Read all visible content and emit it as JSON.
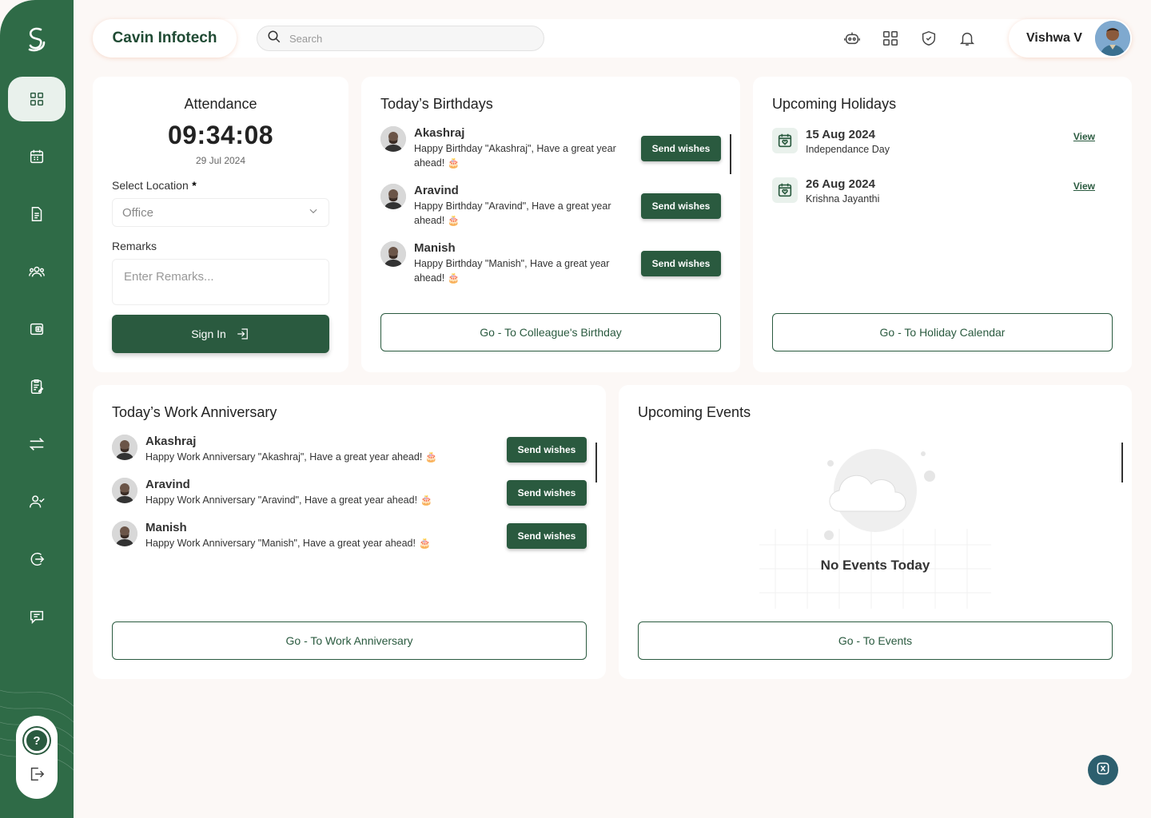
{
  "company": "Cavin Infotech",
  "search": {
    "placeholder": "Search"
  },
  "user": {
    "name": "Vishwa V"
  },
  "attendance": {
    "title": "Attendance",
    "time": "09:34:08",
    "date": "29 Jul 2024",
    "location_label": "Select Location",
    "required_mark": "*",
    "location_value": "Office",
    "remarks_label": "Remarks",
    "remarks_placeholder": "Enter Remarks...",
    "signin_label": "Sign In"
  },
  "birthdays": {
    "title": "Today’s Birthdays",
    "items": [
      {
        "name": "Akashraj",
        "message": "Happy Birthday \"Akashraj\", Have a great year ahead! 🎂"
      },
      {
        "name": "Aravind",
        "message": "Happy Birthday \"Aravind\", Have a great year ahead! 🎂"
      },
      {
        "name": "Manish",
        "message": "Happy Birthday \"Manish\", Have a great year ahead! 🎂"
      }
    ],
    "wish_label": "Send wishes",
    "goto_label": "Go - To  Colleague's Birthday"
  },
  "holidays": {
    "title": "Upcoming Holidays",
    "items": [
      {
        "date": "15 Aug 2024",
        "name": "Independance Day",
        "action": "View"
      },
      {
        "date": "26 Aug 2024",
        "name": "Krishna Jayanthi",
        "action": "View"
      }
    ],
    "goto_label": "Go - To  Holiday Calendar"
  },
  "anniversary": {
    "title": "Today’s Work Anniversary",
    "items": [
      {
        "name": "Akashraj",
        "message": "Happy Work Anniversary \"Akashraj\", Have a great year ahead! 🎂"
      },
      {
        "name": "Aravind",
        "message": "Happy Work Anniversary \"Aravind\", Have a great year ahead! 🎂"
      },
      {
        "name": "Manish",
        "message": "Happy Work Anniversary \"Manish\", Have a great year ahead! 🎂"
      }
    ],
    "wish_label": "Send wishes",
    "goto_label": "Go - To  Work Anniversary"
  },
  "events": {
    "title": "Upcoming Events",
    "empty_text": "No Events Today",
    "goto_label": "Go - To  Events"
  },
  "colors": {
    "primary": "#2a5a3f",
    "sidebar": "#2f6b47",
    "background": "#fcf8f6"
  }
}
